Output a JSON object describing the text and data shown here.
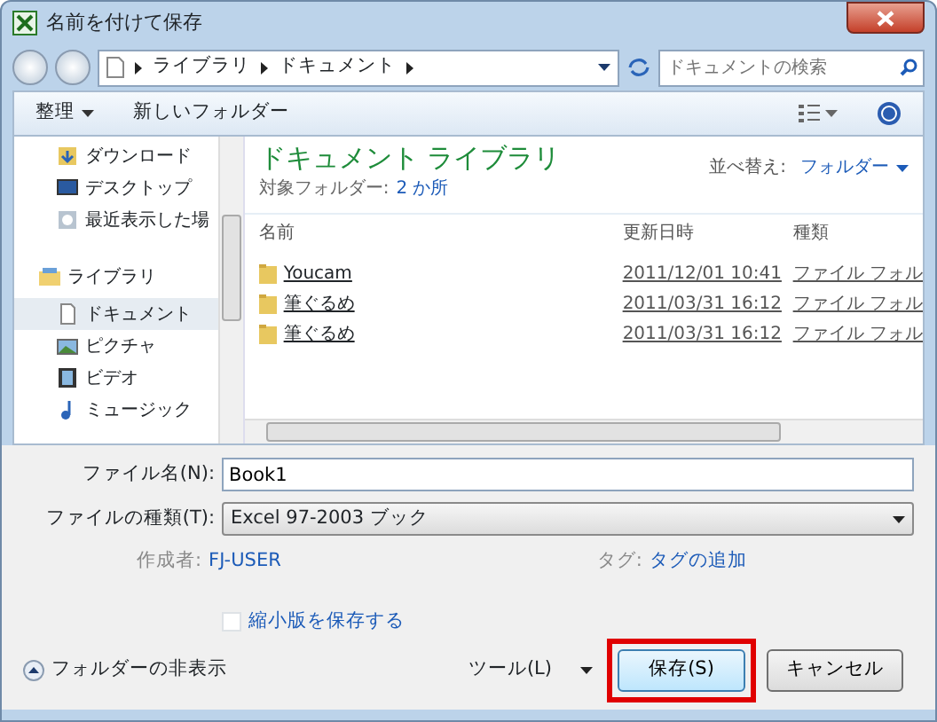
{
  "window": {
    "title": "名前を付けて保存"
  },
  "address": {
    "crumbs": [
      "ライブラリ",
      "ドキュメント"
    ],
    "search_placeholder": "ドキュメントの検索"
  },
  "toolbar": {
    "organize": "整理",
    "new_folder": "新しいフォルダー"
  },
  "sidebar": {
    "items": [
      {
        "label": "ダウンロード",
        "kind": "item",
        "selected": false
      },
      {
        "label": "デスクトップ",
        "kind": "item",
        "selected": false
      },
      {
        "label": "最近表示した場",
        "kind": "item",
        "selected": false
      },
      {
        "label": "ライブラリ",
        "kind": "group",
        "selected": false
      },
      {
        "label": "ドキュメント",
        "kind": "item",
        "selected": true
      },
      {
        "label": "ピクチャ",
        "kind": "item",
        "selected": false
      },
      {
        "label": "ビデオ",
        "kind": "item",
        "selected": false
      },
      {
        "label": "ミュージック",
        "kind": "item",
        "selected": false
      }
    ]
  },
  "library": {
    "title": "ドキュメント ライブラリ",
    "target_label": "対象フォルダー:",
    "target_value": "2 か所",
    "sort_label": "並べ替え:",
    "sort_value": "フォルダー"
  },
  "table": {
    "columns": [
      "名前",
      "更新日時",
      "種類"
    ],
    "rows": [
      {
        "name": "Youcam",
        "date": "2011/12/01 10:41",
        "type": "ファイル フォル"
      },
      {
        "name": "筆ぐるめ",
        "date": "2011/03/31 16:12",
        "type": "ファイル フォル"
      },
      {
        "name": "筆ぐるめ",
        "date": "2011/03/31 16:12",
        "type": "ファイル フォル"
      }
    ]
  },
  "form": {
    "filename_label": "ファイル名(N):",
    "filename_value": "Book1",
    "filetype_label": "ファイルの種類(T):",
    "filetype_value": "Excel 97-2003 ブック",
    "author_label": "作成者:",
    "author_value": "FJ-USER",
    "tag_label": "タグ:",
    "tag_value": "タグの追加",
    "thumbnail_label": "縮小版を保存する",
    "thumbnail_checked": false
  },
  "footer": {
    "hide_folders": "フォルダーの非表示",
    "tools": "ツール(L)",
    "buttons": [
      {
        "label": "保存(S)",
        "highlighted": true,
        "default": true
      },
      {
        "label": "キャンセル",
        "highlighted": false,
        "default": false
      }
    ]
  }
}
